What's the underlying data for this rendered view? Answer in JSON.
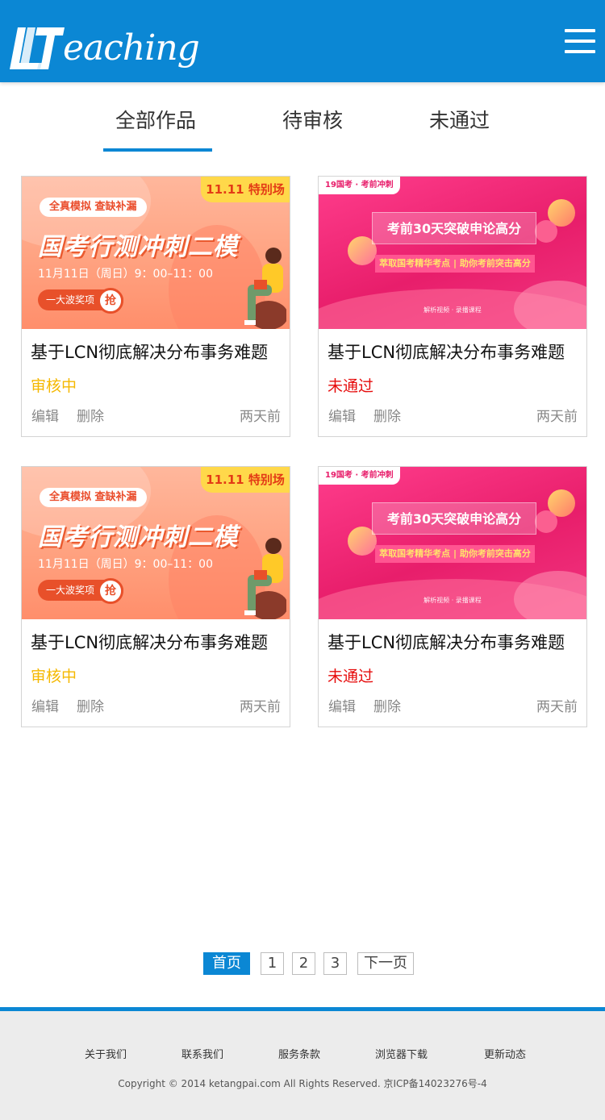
{
  "header": {
    "logo_text": "eaching",
    "logo_mark": "LT",
    "menu_icon": "hamburger-menu-icon",
    "color": "#0b87d4"
  },
  "tabs": [
    {
      "label": "全部作品",
      "active": true
    },
    {
      "label": "待审核",
      "active": false
    },
    {
      "label": "未通过",
      "active": false
    }
  ],
  "cards": [
    {
      "title": "基于LCN彻底解决分布事务难题",
      "status": "审核中",
      "status_color": "#f5b800",
      "edit": "编辑",
      "delete": "删除",
      "time": "两天前",
      "thumb": {
        "tag": "11.11 特别场",
        "pill": "全真模拟 查缺补漏",
        "headline": "国考行测冲刺二模",
        "date": "11月11日（周日）9：00–11：00",
        "badge": "一大波奖项",
        "badge_circle": "抢"
      }
    },
    {
      "title": "基于LCN彻底解决分布事务难题",
      "status": "未通过",
      "status_color": "#e60b0b",
      "edit": "编辑",
      "delete": "删除",
      "time": "两天前",
      "thumb": {
        "tag": "19国考 · 考前冲刺",
        "headline": "考前30天突破申论高分",
        "sub": "萃取国考精华考点 | 助你考前突击高分",
        "foot": "解析视频 · 录播课程"
      }
    },
    {
      "title": "基于LCN彻底解决分布事务难题",
      "status": "审核中",
      "status_color": "#f5b800",
      "edit": "编辑",
      "delete": "删除",
      "time": "两天前",
      "thumb": {
        "tag": "11.11 特别场",
        "pill": "全真模拟 查缺补漏",
        "headline": "国考行测冲刺二模",
        "date": "11月11日（周日）9：00–11：00",
        "badge": "一大波奖项",
        "badge_circle": "抢"
      }
    },
    {
      "title": "基于LCN彻底解决分布事务难题",
      "status": "未通过",
      "status_color": "#e60b0b",
      "edit": "编辑",
      "delete": "删除",
      "time": "两天前",
      "thumb": {
        "tag": "19国考 · 考前冲刺",
        "headline": "考前30天突破申论高分",
        "sub": "萃取国考精华考点 | 助你考前突击高分",
        "foot": "解析视频 · 录播课程"
      }
    }
  ],
  "pagination": {
    "first": "首页",
    "pages": [
      "1",
      "2",
      "3"
    ],
    "next": "下一页"
  },
  "footer": {
    "links": [
      "关于我们",
      "联系我们",
      "服务条款",
      "浏览器下载",
      "更新动态"
    ],
    "copyright": "Copyright © 2014 ketangpai.com All Rights Reserved. 京ICP备14023276号-4"
  }
}
